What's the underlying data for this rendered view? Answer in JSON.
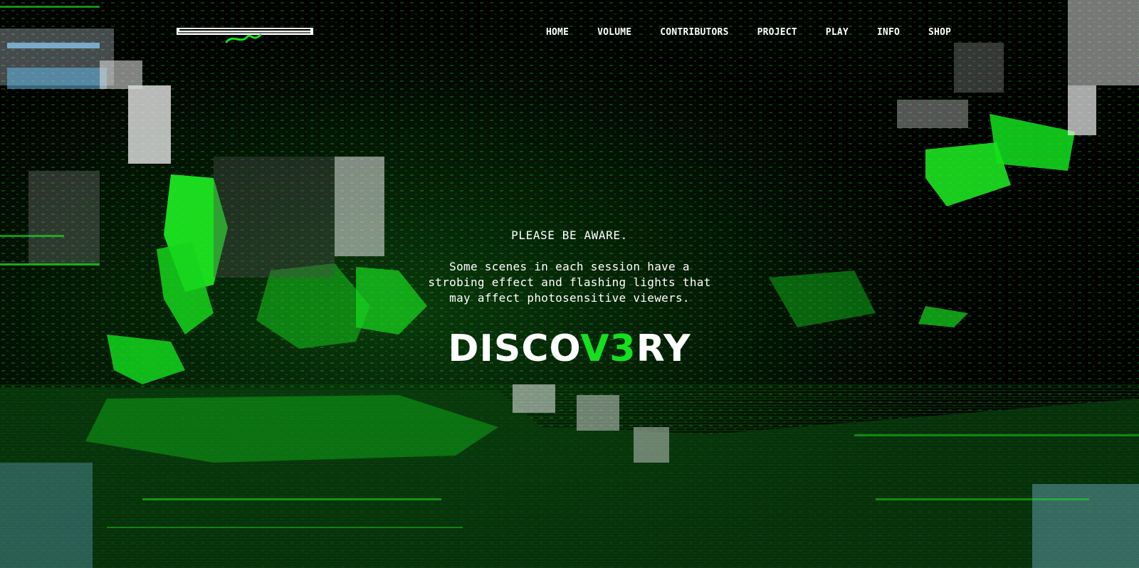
{
  "colors": {
    "background": "#000000",
    "accent": "#14e01e",
    "text": "#ffffff"
  },
  "logo": {
    "icon": "extended-logo",
    "main_text": "EXTENDED",
    "script_text": "layla"
  },
  "nav": {
    "items": [
      "HOME",
      "VOLUME",
      "CONTRIBUTORS",
      "PROJECT",
      "PLAY",
      "INFO",
      "SHOP"
    ]
  },
  "warning": {
    "title": "PLEASE BE AWARE.",
    "lines": [
      "Some scenes in each session have a",
      "strobing effect and flashing lights that",
      "may affect photosensitive viewers."
    ]
  },
  "title": {
    "part1": "DISC",
    "part2": "O",
    "part3": "V3",
    "part4": "RY"
  }
}
